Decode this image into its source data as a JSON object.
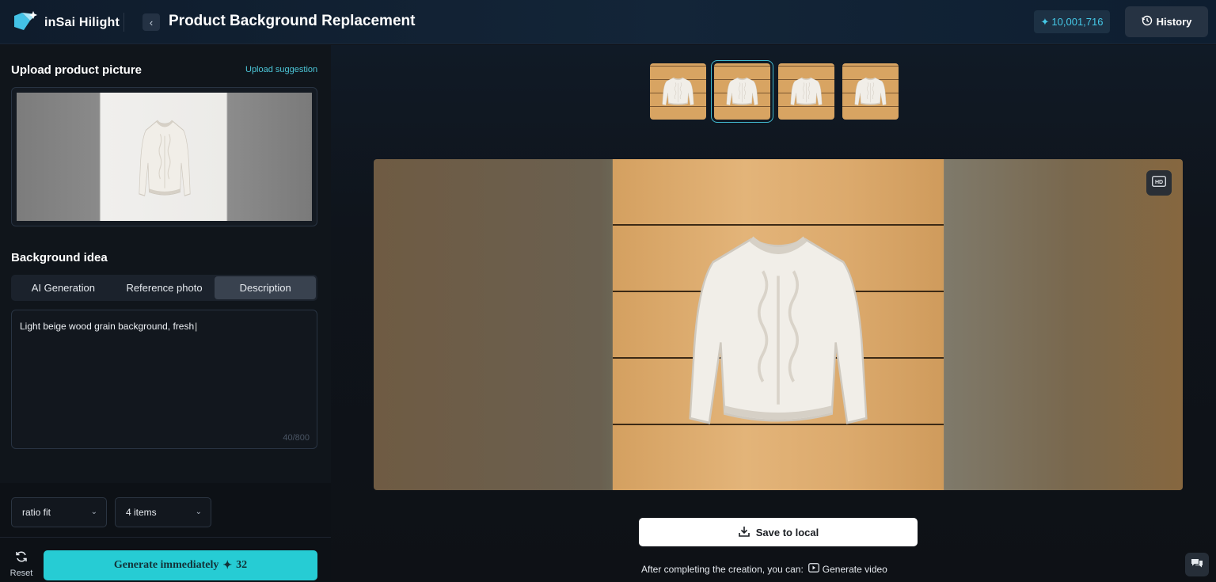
{
  "header": {
    "logo_text": "inSai Hilight",
    "page_title": "Product Background Replacement",
    "credits": "10,001,716",
    "history_label": "History"
  },
  "left": {
    "upload_title": "Upload product picture",
    "upload_suggestion": "Upload suggestion",
    "background_title": "Background idea",
    "tabs": [
      {
        "label": "AI Generation",
        "active": false
      },
      {
        "label": "Reference photo",
        "active": false
      },
      {
        "label": "Description",
        "active": true
      }
    ],
    "description_value": "Light beige wood grain background, fresh",
    "char_count": "40/800",
    "ratio_select": "ratio fit",
    "count_select": "4 items",
    "reset_label": "Reset",
    "generate_label": "Generate immediately",
    "generate_cost": "32"
  },
  "right": {
    "thumbnails": [
      "result-1",
      "result-2",
      "result-3",
      "result-4"
    ],
    "selected_thumbnail": 2,
    "hd_label": "HD",
    "save_label": "Save to local",
    "after_text": "After completing the creation, you can:",
    "generate_video_label": "Generate video"
  },
  "colors": {
    "accent": "#26ccd4",
    "credits": "#45c8e6",
    "link": "#4cc6d8",
    "background": "#0e1116"
  }
}
